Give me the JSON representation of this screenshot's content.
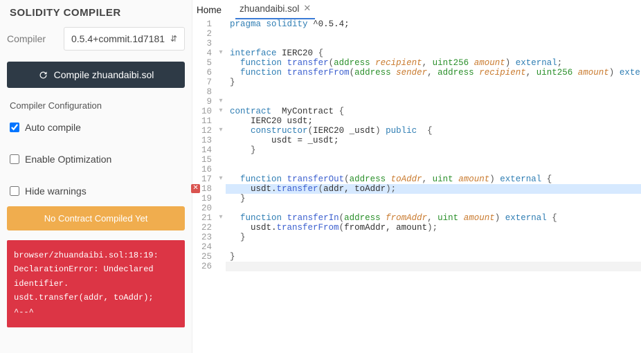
{
  "sidebar": {
    "title": "SOLIDITY COMPILER",
    "compiler_label": "Compiler",
    "compiler_value": "0.5.4+commit.1d7181",
    "compile_button": "Compile zhuandaibi.sol",
    "config_title": "Compiler Configuration",
    "auto_compile": "Auto compile",
    "enable_opt": "Enable Optimization",
    "hide_warnings": "Hide warnings",
    "no_contract_btn": "No Contract Compiled Yet",
    "error_text": "browser/zhuandaibi.sol:18:19:\nDeclarationError: Undeclared\nidentifier.\nusdt.transfer(addr, toAddr);\n^--^"
  },
  "tabs": {
    "home": "Home",
    "file": "zhuandaibi.sol"
  },
  "code": {
    "line_count": 26,
    "error_line": 18,
    "fold_lines": [
      4,
      9,
      10,
      12,
      17,
      21
    ],
    "lines": [
      [
        [
          "kw",
          "pragma solidity"
        ],
        [
          "plain",
          " ^0.5.4;"
        ]
      ],
      [],
      [],
      [
        [
          "kw",
          "interface"
        ],
        [
          "plain",
          " IERC20 "
        ],
        [
          "punc",
          "{"
        ]
      ],
      [
        [
          "plain",
          "  "
        ],
        [
          "kw",
          "function"
        ],
        [
          "plain",
          " "
        ],
        [
          "func",
          "transfer"
        ],
        [
          "punc",
          "("
        ],
        [
          "type",
          "address"
        ],
        [
          "plain",
          " "
        ],
        [
          "param",
          "recipient"
        ],
        [
          "punc",
          ", "
        ],
        [
          "type",
          "uint256"
        ],
        [
          "plain",
          " "
        ],
        [
          "param",
          "amount"
        ],
        [
          "punc",
          ")"
        ],
        [
          "plain",
          " "
        ],
        [
          "kw",
          "external"
        ],
        [
          "punc",
          ";"
        ]
      ],
      [
        [
          "plain",
          "  "
        ],
        [
          "kw",
          "function"
        ],
        [
          "plain",
          " "
        ],
        [
          "func",
          "transferFrom"
        ],
        [
          "punc",
          "("
        ],
        [
          "type",
          "address"
        ],
        [
          "plain",
          " "
        ],
        [
          "param",
          "sender"
        ],
        [
          "punc",
          ", "
        ],
        [
          "type",
          "address"
        ],
        [
          "plain",
          " "
        ],
        [
          "param",
          "recipient"
        ],
        [
          "punc",
          ", "
        ],
        [
          "type",
          "uint256"
        ],
        [
          "plain",
          " "
        ],
        [
          "param",
          "amount"
        ],
        [
          "punc",
          ")"
        ],
        [
          "plain",
          " "
        ],
        [
          "kw",
          "external"
        ],
        [
          "plain",
          " ;"
        ]
      ],
      [
        [
          "punc",
          "}"
        ]
      ],
      [],
      [],
      [
        [
          "kw",
          "contract"
        ],
        [
          "plain",
          "  MyContract "
        ],
        [
          "punc",
          "{"
        ]
      ],
      [
        [
          "plain",
          "    IERC20 usdt;"
        ]
      ],
      [
        [
          "plain",
          "    "
        ],
        [
          "kw",
          "constructor"
        ],
        [
          "punc",
          "("
        ],
        [
          "plain",
          "IERC20 _usdt"
        ],
        [
          "punc",
          ")"
        ],
        [
          "plain",
          " "
        ],
        [
          "kw",
          "public"
        ],
        [
          "plain",
          "  "
        ],
        [
          "punc",
          "{"
        ]
      ],
      [
        [
          "plain",
          "        usdt = _usdt;"
        ]
      ],
      [
        [
          "plain",
          "    "
        ],
        [
          "punc",
          "}"
        ]
      ],
      [],
      [],
      [
        [
          "plain",
          "  "
        ],
        [
          "kw",
          "function"
        ],
        [
          "plain",
          " "
        ],
        [
          "func",
          "transferOut"
        ],
        [
          "punc",
          "("
        ],
        [
          "type",
          "address"
        ],
        [
          "plain",
          " "
        ],
        [
          "param",
          "toAddr"
        ],
        [
          "punc",
          ", "
        ],
        [
          "type",
          "uint"
        ],
        [
          "plain",
          " "
        ],
        [
          "param",
          "amount"
        ],
        [
          "punc",
          ")"
        ],
        [
          "plain",
          " "
        ],
        [
          "kw",
          "external"
        ],
        [
          "plain",
          " "
        ],
        [
          "punc",
          "{"
        ]
      ],
      [
        [
          "plain",
          "    usdt."
        ],
        [
          "func",
          "transfer"
        ],
        [
          "punc",
          "("
        ],
        [
          "plain",
          "addr, toAddr"
        ],
        [
          "punc",
          ");"
        ]
      ],
      [
        [
          "plain",
          "  "
        ],
        [
          "punc",
          "}"
        ]
      ],
      [],
      [
        [
          "plain",
          "  "
        ],
        [
          "kw",
          "function"
        ],
        [
          "plain",
          " "
        ],
        [
          "func",
          "transferIn"
        ],
        [
          "punc",
          "("
        ],
        [
          "type",
          "address"
        ],
        [
          "plain",
          " "
        ],
        [
          "param",
          "fromAddr"
        ],
        [
          "punc",
          ", "
        ],
        [
          "type",
          "uint"
        ],
        [
          "plain",
          " "
        ],
        [
          "param",
          "amount"
        ],
        [
          "punc",
          ")"
        ],
        [
          "plain",
          " "
        ],
        [
          "kw",
          "external"
        ],
        [
          "plain",
          " "
        ],
        [
          "punc",
          "{"
        ]
      ],
      [
        [
          "plain",
          "    usdt."
        ],
        [
          "func",
          "transferFrom"
        ],
        [
          "punc",
          "("
        ],
        [
          "plain",
          "fromAddr, amount"
        ],
        [
          "punc",
          ");"
        ]
      ],
      [
        [
          "plain",
          "  "
        ],
        [
          "punc",
          "}"
        ]
      ],
      [],
      [
        [
          "punc",
          "}"
        ]
      ],
      []
    ]
  }
}
